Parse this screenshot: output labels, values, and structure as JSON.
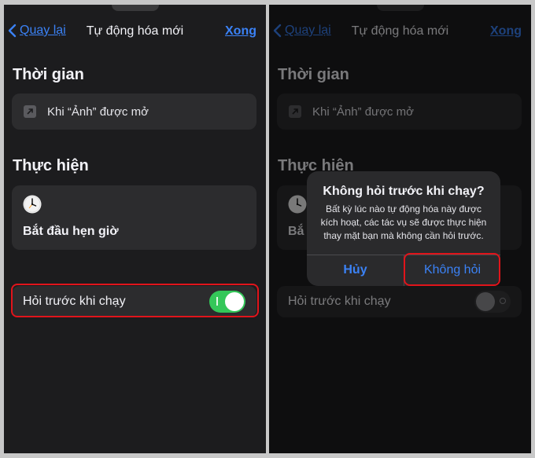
{
  "left": {
    "nav": {
      "back": "Quay lại",
      "title": "Tự động hóa mới",
      "done": "Xong"
    },
    "trigger_section": "Thời gian",
    "trigger_text": "Khi “Ảnh” được mở",
    "action_section": "Thực hiện",
    "action_text": "Bắt đầu hẹn giờ",
    "ask_label": "Hỏi trước khi chạy",
    "ask_toggle": "on"
  },
  "right": {
    "nav": {
      "back": "Quay lại",
      "title": "Tự động hóa mới",
      "done": "Xong"
    },
    "trigger_section": "Thời gian",
    "trigger_text": "Khi “Ảnh” được mở",
    "action_section": "Thực hiện",
    "action_text_partial": "Bắ",
    "ask_label": "Hỏi trước khi chạy",
    "ask_toggle": "off",
    "dialog": {
      "title": "Không hỏi trước khi chạy?",
      "message": "Bất kỳ lúc nào tự động hóa này được kích hoạt, các tác vụ sẽ được thực hiện thay mặt bạn mà không cần hỏi trước.",
      "cancel": "Hủy",
      "confirm": "Không hỏi"
    }
  },
  "colors": {
    "accent": "#3b82f6",
    "toggle_on": "#34c759",
    "highlight": "#e1141b",
    "background": "#1c1c1e",
    "card": "#2c2c2e"
  },
  "icons": [
    "chevron-left-icon",
    "arrow-out-icon",
    "clock-icon"
  ]
}
